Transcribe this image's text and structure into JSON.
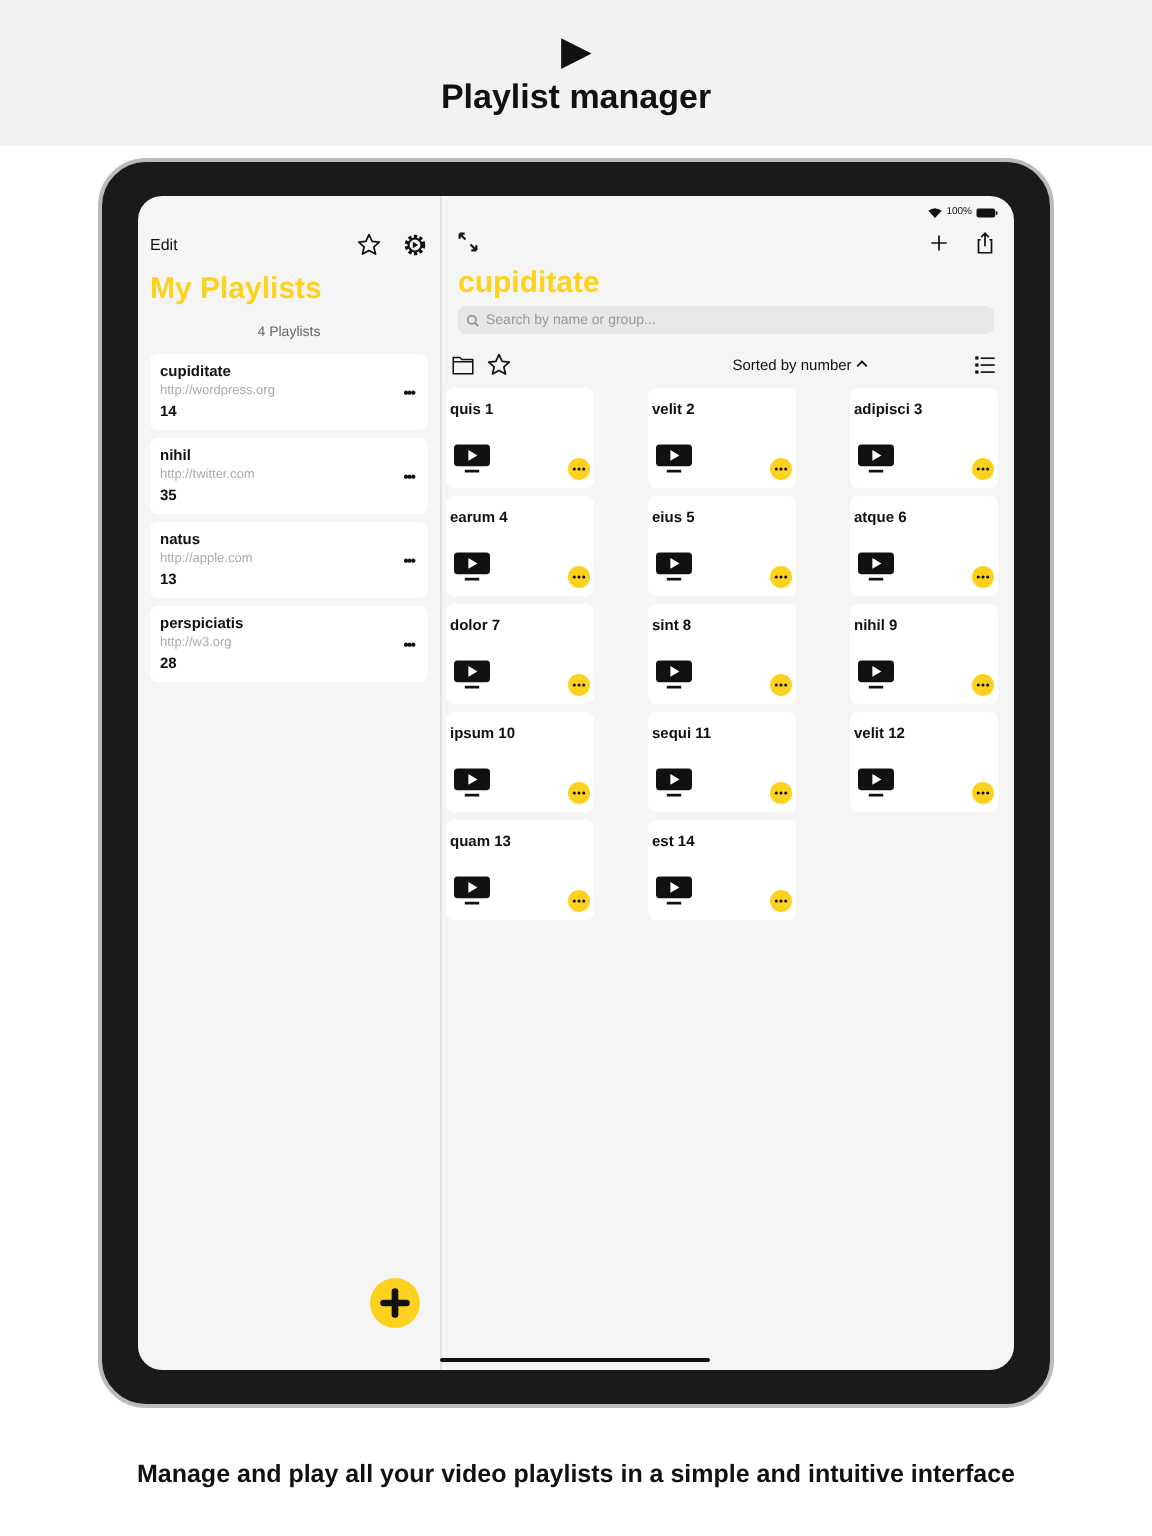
{
  "header": {
    "icon": "▶",
    "title": "Playlist manager"
  },
  "status_bar": {
    "battery": "100%"
  },
  "sidebar": {
    "edit": "Edit",
    "title": "My Playlists",
    "count": "4 Playlists",
    "playlists": [
      {
        "name": "cupiditate",
        "url": "http://wordpress.org",
        "count": "14",
        "more": "•••"
      },
      {
        "name": "nihil",
        "url": "http://twitter.com",
        "count": "35",
        "more": "•••"
      },
      {
        "name": "natus",
        "url": "http://apple.com",
        "count": "13",
        "more": "•••"
      },
      {
        "name": "perspiciatis",
        "url": "http://w3.org",
        "count": "28",
        "more": "•••"
      }
    ]
  },
  "detail": {
    "title": "cupiditate",
    "search": {
      "placeholder": "Search by name or group..."
    },
    "sort": "Sorted by number",
    "videos": [
      {
        "name": "quis 1"
      },
      {
        "name": "velit 2"
      },
      {
        "name": "adipisci 3"
      },
      {
        "name": "earum 4"
      },
      {
        "name": "eius 5"
      },
      {
        "name": "atque 6"
      },
      {
        "name": "dolor 7"
      },
      {
        "name": "sint 8"
      },
      {
        "name": "nihil 9"
      },
      {
        "name": "ipsum 10"
      },
      {
        "name": "sequi 11"
      },
      {
        "name": "velit 12"
      },
      {
        "name": "quam 13"
      },
      {
        "name": "est 14"
      }
    ]
  },
  "caption": "Manage and play all your video playlists in a simple and intuitive interface"
}
